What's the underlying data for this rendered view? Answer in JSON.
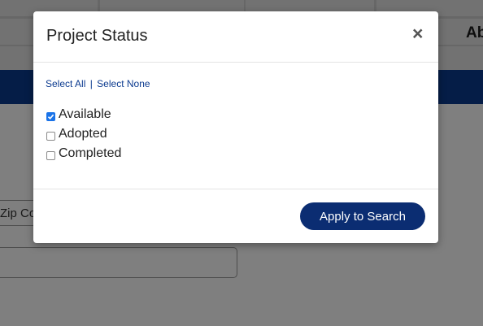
{
  "background": {
    "about_label": "Ab",
    "zip_placeholder": "Zip Co"
  },
  "modal": {
    "title": "Project Status",
    "close_symbol": "×",
    "select_all": "Select All",
    "separator": "|",
    "select_none": "Select None",
    "statuses": [
      {
        "label": "Available",
        "checked": true
      },
      {
        "label": "Adopted",
        "checked": false
      },
      {
        "label": "Completed",
        "checked": false
      }
    ],
    "apply_label": "Apply to Search"
  },
  "colors": {
    "primary": "#0b2d72",
    "nav": "#0b3a8f",
    "checkbox_checked": "#1a73e8"
  }
}
